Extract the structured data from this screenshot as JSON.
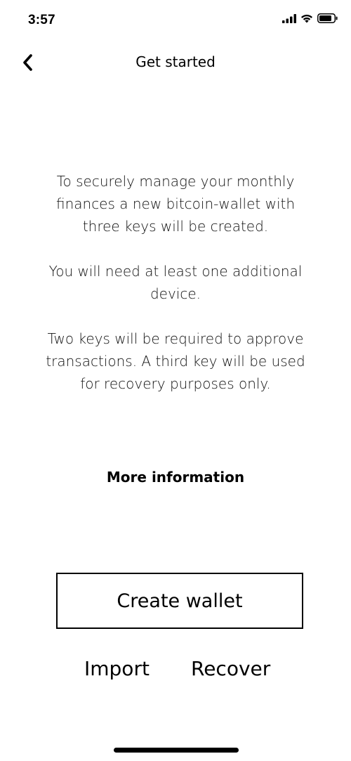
{
  "status_bar": {
    "time": "3:57",
    "icons": [
      "signal-icon",
      "wifi-icon",
      "battery-icon"
    ]
  },
  "nav": {
    "title": "Get started",
    "back_icon": "chevron-left-icon"
  },
  "intro": {
    "paragraph_1": "To securely manage your monthly finances a new bitcoin-wallet with three keys will be created.",
    "paragraph_2": "You will need at least one additional device.",
    "paragraph_3": "Two keys will be required to approve transactions. A third key will be used for recovery purposes only."
  },
  "links": {
    "more_information": "More information"
  },
  "actions": {
    "create_wallet": "Create wallet",
    "import": "Import",
    "recover": "Recover"
  }
}
